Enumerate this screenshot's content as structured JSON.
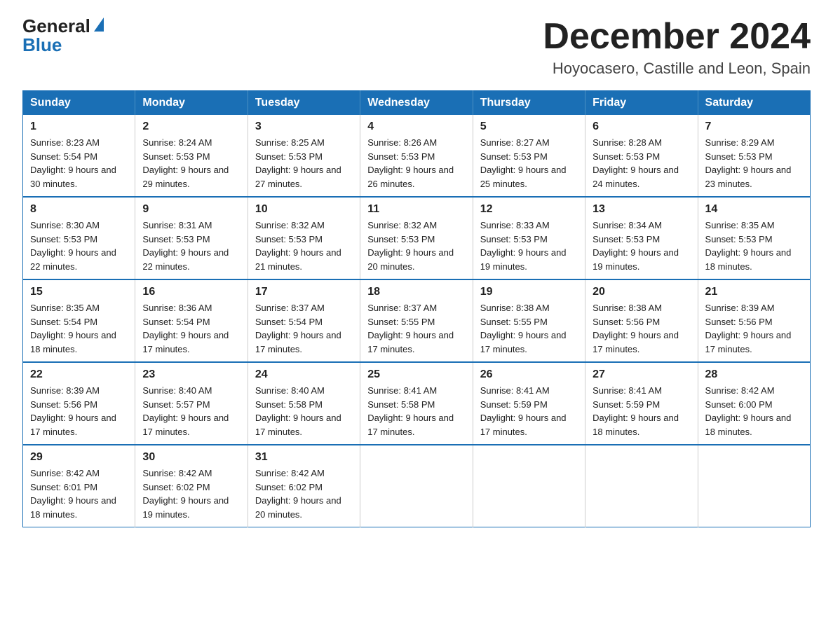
{
  "header": {
    "logo_line1": "General",
    "logo_line2": "Blue",
    "title": "December 2024",
    "subtitle": "Hoyocasero, Castille and Leon, Spain"
  },
  "columns": [
    "Sunday",
    "Monday",
    "Tuesday",
    "Wednesday",
    "Thursday",
    "Friday",
    "Saturday"
  ],
  "weeks": [
    [
      {
        "day": "1",
        "sunrise": "Sunrise: 8:23 AM",
        "sunset": "Sunset: 5:54 PM",
        "daylight": "Daylight: 9 hours and 30 minutes."
      },
      {
        "day": "2",
        "sunrise": "Sunrise: 8:24 AM",
        "sunset": "Sunset: 5:53 PM",
        "daylight": "Daylight: 9 hours and 29 minutes."
      },
      {
        "day": "3",
        "sunrise": "Sunrise: 8:25 AM",
        "sunset": "Sunset: 5:53 PM",
        "daylight": "Daylight: 9 hours and 27 minutes."
      },
      {
        "day": "4",
        "sunrise": "Sunrise: 8:26 AM",
        "sunset": "Sunset: 5:53 PM",
        "daylight": "Daylight: 9 hours and 26 minutes."
      },
      {
        "day": "5",
        "sunrise": "Sunrise: 8:27 AM",
        "sunset": "Sunset: 5:53 PM",
        "daylight": "Daylight: 9 hours and 25 minutes."
      },
      {
        "day": "6",
        "sunrise": "Sunrise: 8:28 AM",
        "sunset": "Sunset: 5:53 PM",
        "daylight": "Daylight: 9 hours and 24 minutes."
      },
      {
        "day": "7",
        "sunrise": "Sunrise: 8:29 AM",
        "sunset": "Sunset: 5:53 PM",
        "daylight": "Daylight: 9 hours and 23 minutes."
      }
    ],
    [
      {
        "day": "8",
        "sunrise": "Sunrise: 8:30 AM",
        "sunset": "Sunset: 5:53 PM",
        "daylight": "Daylight: 9 hours and 22 minutes."
      },
      {
        "day": "9",
        "sunrise": "Sunrise: 8:31 AM",
        "sunset": "Sunset: 5:53 PM",
        "daylight": "Daylight: 9 hours and 22 minutes."
      },
      {
        "day": "10",
        "sunrise": "Sunrise: 8:32 AM",
        "sunset": "Sunset: 5:53 PM",
        "daylight": "Daylight: 9 hours and 21 minutes."
      },
      {
        "day": "11",
        "sunrise": "Sunrise: 8:32 AM",
        "sunset": "Sunset: 5:53 PM",
        "daylight": "Daylight: 9 hours and 20 minutes."
      },
      {
        "day": "12",
        "sunrise": "Sunrise: 8:33 AM",
        "sunset": "Sunset: 5:53 PM",
        "daylight": "Daylight: 9 hours and 19 minutes."
      },
      {
        "day": "13",
        "sunrise": "Sunrise: 8:34 AM",
        "sunset": "Sunset: 5:53 PM",
        "daylight": "Daylight: 9 hours and 19 minutes."
      },
      {
        "day": "14",
        "sunrise": "Sunrise: 8:35 AM",
        "sunset": "Sunset: 5:53 PM",
        "daylight": "Daylight: 9 hours and 18 minutes."
      }
    ],
    [
      {
        "day": "15",
        "sunrise": "Sunrise: 8:35 AM",
        "sunset": "Sunset: 5:54 PM",
        "daylight": "Daylight: 9 hours and 18 minutes."
      },
      {
        "day": "16",
        "sunrise": "Sunrise: 8:36 AM",
        "sunset": "Sunset: 5:54 PM",
        "daylight": "Daylight: 9 hours and 17 minutes."
      },
      {
        "day": "17",
        "sunrise": "Sunrise: 8:37 AM",
        "sunset": "Sunset: 5:54 PM",
        "daylight": "Daylight: 9 hours and 17 minutes."
      },
      {
        "day": "18",
        "sunrise": "Sunrise: 8:37 AM",
        "sunset": "Sunset: 5:55 PM",
        "daylight": "Daylight: 9 hours and 17 minutes."
      },
      {
        "day": "19",
        "sunrise": "Sunrise: 8:38 AM",
        "sunset": "Sunset: 5:55 PM",
        "daylight": "Daylight: 9 hours and 17 minutes."
      },
      {
        "day": "20",
        "sunrise": "Sunrise: 8:38 AM",
        "sunset": "Sunset: 5:56 PM",
        "daylight": "Daylight: 9 hours and 17 minutes."
      },
      {
        "day": "21",
        "sunrise": "Sunrise: 8:39 AM",
        "sunset": "Sunset: 5:56 PM",
        "daylight": "Daylight: 9 hours and 17 minutes."
      }
    ],
    [
      {
        "day": "22",
        "sunrise": "Sunrise: 8:39 AM",
        "sunset": "Sunset: 5:56 PM",
        "daylight": "Daylight: 9 hours and 17 minutes."
      },
      {
        "day": "23",
        "sunrise": "Sunrise: 8:40 AM",
        "sunset": "Sunset: 5:57 PM",
        "daylight": "Daylight: 9 hours and 17 minutes."
      },
      {
        "day": "24",
        "sunrise": "Sunrise: 8:40 AM",
        "sunset": "Sunset: 5:58 PM",
        "daylight": "Daylight: 9 hours and 17 minutes."
      },
      {
        "day": "25",
        "sunrise": "Sunrise: 8:41 AM",
        "sunset": "Sunset: 5:58 PM",
        "daylight": "Daylight: 9 hours and 17 minutes."
      },
      {
        "day": "26",
        "sunrise": "Sunrise: 8:41 AM",
        "sunset": "Sunset: 5:59 PM",
        "daylight": "Daylight: 9 hours and 17 minutes."
      },
      {
        "day": "27",
        "sunrise": "Sunrise: 8:41 AM",
        "sunset": "Sunset: 5:59 PM",
        "daylight": "Daylight: 9 hours and 18 minutes."
      },
      {
        "day": "28",
        "sunrise": "Sunrise: 8:42 AM",
        "sunset": "Sunset: 6:00 PM",
        "daylight": "Daylight: 9 hours and 18 minutes."
      }
    ],
    [
      {
        "day": "29",
        "sunrise": "Sunrise: 8:42 AM",
        "sunset": "Sunset: 6:01 PM",
        "daylight": "Daylight: 9 hours and 18 minutes."
      },
      {
        "day": "30",
        "sunrise": "Sunrise: 8:42 AM",
        "sunset": "Sunset: 6:02 PM",
        "daylight": "Daylight: 9 hours and 19 minutes."
      },
      {
        "day": "31",
        "sunrise": "Sunrise: 8:42 AM",
        "sunset": "Sunset: 6:02 PM",
        "daylight": "Daylight: 9 hours and 20 minutes."
      },
      null,
      null,
      null,
      null
    ]
  ]
}
